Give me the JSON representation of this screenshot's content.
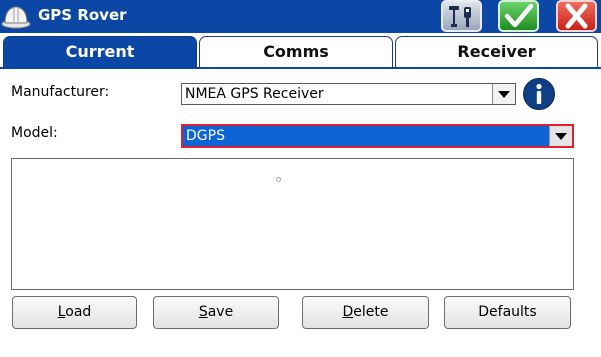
{
  "window": {
    "title": "GPS Rover",
    "colors": {
      "titlebar": "#0d47a6",
      "accent": "#0b63d6",
      "highlight_border": "#e0202a"
    }
  },
  "toolbar": {
    "connect_icon": "gps-antenna-icon",
    "ok_icon": "checkmark-icon",
    "close_icon": "close-x-icon"
  },
  "tabs": [
    {
      "label": "Current",
      "active": true
    },
    {
      "label": "Comms",
      "active": false
    },
    {
      "label": "Receiver",
      "active": false
    }
  ],
  "form": {
    "manufacturer_label": "Manufacturer:",
    "manufacturer_value": "NMEA GPS Receiver",
    "model_label": "Model:",
    "model_value": "DGPS",
    "info_icon": "info-icon"
  },
  "buttons": {
    "load_first": "L",
    "load_rest": "oad",
    "save_first": "S",
    "save_rest": "ave",
    "delete_first": "D",
    "delete_rest": "elete",
    "defaults": "Defaults"
  }
}
